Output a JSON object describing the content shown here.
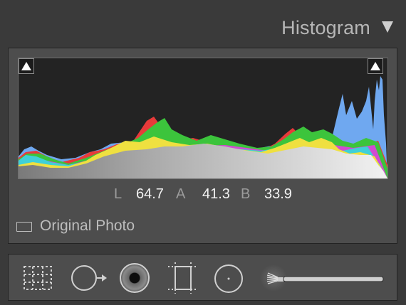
{
  "panel": {
    "title": "Histogram",
    "collapse_icon": "triangle-down-icon"
  },
  "histogram": {
    "shadow_clipping_icon": "triangle-up-icon",
    "highlight_clipping_icon": "triangle-up-icon",
    "channels": [
      "red",
      "green",
      "blue",
      "yellow",
      "cyan",
      "magenta",
      "luminance"
    ]
  },
  "lab": {
    "l_label": "L",
    "l_value": "64.7",
    "a_label": "A",
    "a_value": "41.3",
    "b_label": "B",
    "b_value": "33.9"
  },
  "original_photo": {
    "label": "Original Photo",
    "checked": false
  },
  "toolbar": {
    "tools": [
      "crop-overlay-icon",
      "spot-removal-icon",
      "red-eye-icon",
      "graduated-filter-icon",
      "radial-filter-icon",
      "adjustment-brush-icon"
    ],
    "slider_icon": "brush-size-slider"
  },
  "colors": {
    "background": "#3a3a3a",
    "panel": "#4d4d4d",
    "histogram_bg": "#232323"
  }
}
